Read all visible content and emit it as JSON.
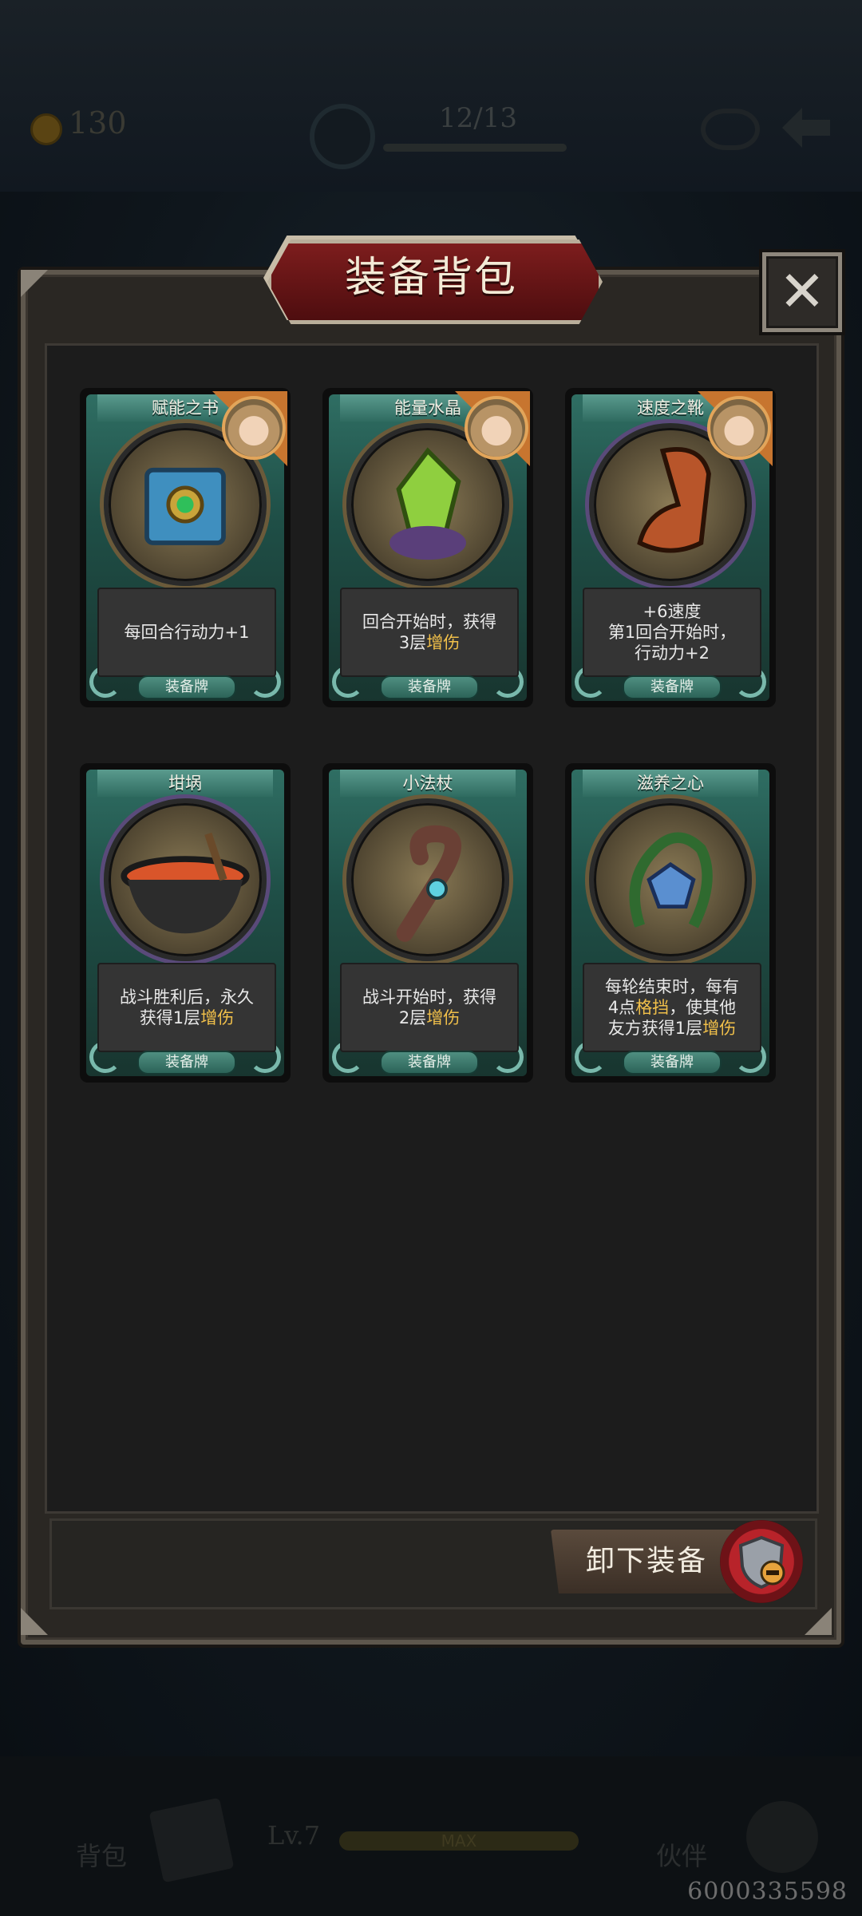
{
  "hud": {
    "coins": "130",
    "progress": "12/13"
  },
  "modal": {
    "title": "装备背包",
    "unequip_label": "卸下装备"
  },
  "cards": [
    {
      "name": "赋能之书",
      "desc_parts": [
        {
          "t": "每回合行动力+1",
          "hl": false
        }
      ],
      "tag": "装备牌",
      "has_avatar": true,
      "art": "book-icon",
      "frame": "#6b5a3a"
    },
    {
      "name": "能量水晶",
      "desc_parts": [
        {
          "t": "回合开始时，获得",
          "hl": false
        },
        {
          "br": true
        },
        {
          "t": "3层",
          "hl": false
        },
        {
          "t": "增伤",
          "hl": true
        }
      ],
      "tag": "装备牌",
      "has_avatar": true,
      "art": "crystal-icon",
      "frame": "#6b5a3a"
    },
    {
      "name": "速度之靴",
      "desc_parts": [
        {
          "t": "+6速度",
          "hl": false
        },
        {
          "br": true
        },
        {
          "t": "第1回合开始时，",
          "hl": false
        },
        {
          "br": true
        },
        {
          "t": "行动力+2",
          "hl": false
        }
      ],
      "tag": "装备牌",
      "has_avatar": true,
      "art": "boot-icon",
      "frame": "#5a4a7a"
    },
    {
      "name": "坩埚",
      "desc_parts": [
        {
          "t": "战斗胜利后，永久",
          "hl": false
        },
        {
          "br": true
        },
        {
          "t": "获得1层",
          "hl": false
        },
        {
          "t": "增伤",
          "hl": true
        }
      ],
      "tag": "装备牌",
      "has_avatar": false,
      "art": "cauldron-icon",
      "frame": "#5a4a7a"
    },
    {
      "name": "小法杖",
      "desc_parts": [
        {
          "t": "战斗开始时，获得",
          "hl": false
        },
        {
          "br": true
        },
        {
          "t": "2层",
          "hl": false
        },
        {
          "t": "增伤",
          "hl": true
        }
      ],
      "tag": "装备牌",
      "has_avatar": false,
      "art": "staff-icon",
      "frame": "#6b5a3a"
    },
    {
      "name": "滋养之心",
      "desc_parts": [
        {
          "t": "每轮结束时，每有",
          "hl": false
        },
        {
          "br": true
        },
        {
          "t": "4点",
          "hl": false
        },
        {
          "t": "格挡",
          "hl": true
        },
        {
          "t": "，使其他",
          "hl": false
        },
        {
          "br": true
        },
        {
          "t": "友方获得1层",
          "hl": false
        },
        {
          "t": "增伤",
          "hl": true
        }
      ],
      "tag": "装备牌",
      "has_avatar": false,
      "art": "heart-vine-icon",
      "frame": "#6b5a3a"
    }
  ],
  "bottom_bar": {
    "bag_label": "背包",
    "level": "Lv.7",
    "level_status": "MAX",
    "partner_label": "伙伴"
  },
  "user_id": "6000335598"
}
